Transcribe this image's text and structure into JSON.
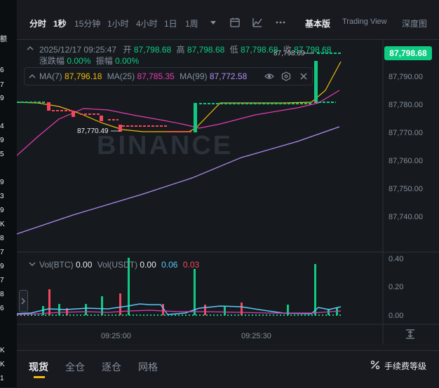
{
  "left_strip": {
    "chars": [
      "额",
      "6",
      "7",
      "9",
      "4",
      "9",
      "5",
      "9",
      "3",
      "9",
      "K",
      "8",
      "7",
      "9",
      "7",
      "8",
      "6",
      "K",
      "K",
      "1"
    ]
  },
  "timeframes": [
    {
      "label": "分时",
      "active": false
    },
    {
      "label": "1秒",
      "active": true
    },
    {
      "label": "15分钟",
      "active": false
    },
    {
      "label": "1小时",
      "active": false
    },
    {
      "label": "4小时",
      "active": false
    },
    {
      "label": "1日",
      "active": false
    },
    {
      "label": "1周",
      "active": false
    }
  ],
  "views": [
    {
      "label": "基本版",
      "active": true
    },
    {
      "label": "Trading View",
      "active": false
    },
    {
      "label": "深度图",
      "active": false
    }
  ],
  "ohlc": {
    "datetime": "2025/12/17 09:25:47",
    "open_label": "开",
    "open": "87,798.68",
    "high_label": "高",
    "high": "87,798.68",
    "low_label": "低",
    "low": "87,798.68",
    "close_label": "收",
    "close": "87,798.68",
    "change_label": "涨跌幅",
    "change": "0.00%",
    "amplitude_label": "振幅",
    "amplitude": "0.00%"
  },
  "ma": {
    "ma7_label": "MA(7)",
    "ma7": "87,796.18",
    "ma7_color": "#f0b90b",
    "ma25_label": "MA(25)",
    "ma25": "87,785.35",
    "ma25_color": "#e63bb4",
    "ma99_label": "MA(99)",
    "ma99": "87,772.58",
    "ma99_color": "#b38cf5"
  },
  "vol": {
    "btc_label": "Vol(BTC)",
    "btc": "0.00",
    "usdt_label": "Vol(USDT)",
    "usdt": "0.00",
    "v1": "0.06",
    "v2": "0.03"
  },
  "price_axis": [
    "87,790.00",
    "87,780.00",
    "87,770.00",
    "87,760.00",
    "87,750.00",
    "87,740.00"
  ],
  "current_price": "87,798.68",
  "high_marker": "87,798.69",
  "low_marker": "87,770.49",
  "volume_axis": [
    "0.40",
    "0.20",
    "0.00"
  ],
  "time_axis": [
    "09:25:00",
    "09:25:30"
  ],
  "watermark": "BINANCE",
  "bottom_tabs": [
    {
      "label": "现货",
      "active": true
    },
    {
      "label": "全仓",
      "active": false
    },
    {
      "label": "逐仓",
      "active": false
    },
    {
      "label": "网格",
      "active": false
    }
  ],
  "fee_label": "手续费等级",
  "colors": {
    "up": "#0ecb81",
    "down": "#f6465d",
    "accent": "#f0b90b"
  }
}
